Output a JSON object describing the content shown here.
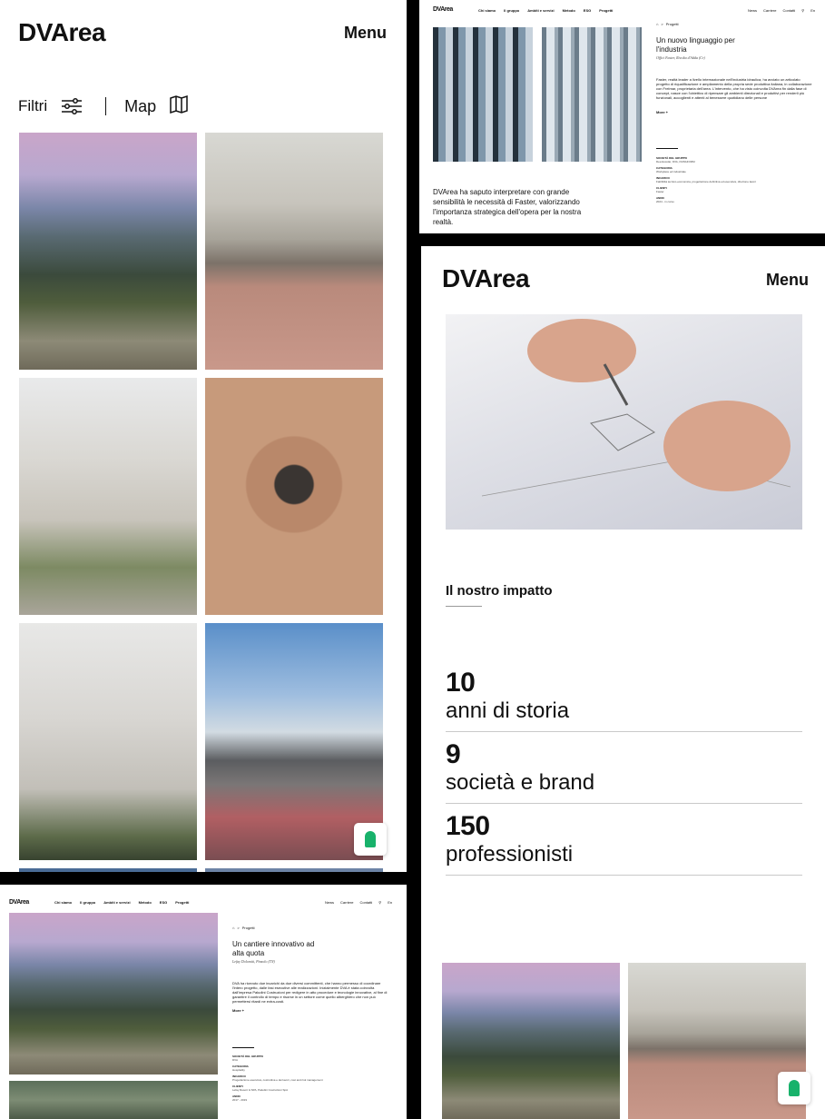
{
  "brand": "DVArea",
  "menu_label": "Menu",
  "filters": {
    "filter_label": "Filtri",
    "map_label": "Map"
  },
  "project_grid": {
    "items": [
      {
        "image": "alpine-chalet-hotel"
      },
      {
        "image": "indoor-athletics-arena"
      },
      {
        "image": "white-residential-building"
      },
      {
        "image": "desert-construction-site"
      },
      {
        "image": "stone-residential-building"
      },
      {
        "image": "velodrome-track-arena"
      }
    ]
  },
  "nav": {
    "items": [
      "Chi siamo",
      "Il gruppo",
      "Ambiti e servizi",
      "Metodo",
      "ESG",
      "Progetti"
    ],
    "right": [
      "News",
      "Carriere",
      "Contatti"
    ],
    "lang": "En"
  },
  "project_faster": {
    "breadcrumb": "Progetti",
    "title": "Un nuovo linguaggio per l'industria",
    "subtitle": "Offici Faster, Rivolta d'Adda (Cr)",
    "body": "Faster, realtà leader a livello internazionale nell'industria idraulica, ha avviato un articolato progetto di riqualificazione e ampliamento della propria sede produttiva italiana, in collaborazione con Frelmar, proprietaria dell'area. L'intervento, che ha visto coinvolta DVArea fin dalla fase di concept, nasce con l'obiettivo di ripensare gli ambienti direzionali e produttivi per renderli più funzionali, accoglienti e attenti al benessere quotidiano delle persone",
    "more": "More +",
    "quote": "DVArea ha saputo interpretare con grande sensibilità le necessità di Faster, valorizzando l'importanza strategica dell'opera per la nostra realtà.",
    "meta": [
      {
        "label": "Società del gruppo",
        "value": "Dea Escolar, DVA, DVRAFORM"
      },
      {
        "label": "Categoria",
        "value": "Workplace ed industriale"
      },
      {
        "label": "Incarico",
        "value": "Fattibilità tecnico-economica, progettazione definitiva ed esecutiva, direzione lavori"
      },
      {
        "label": "Clienti",
        "value": "Faster"
      },
      {
        "label": "Anno",
        "value": "2024 - in corso"
      }
    ]
  },
  "impact": {
    "heading": "Il nostro impatto",
    "stats": [
      {
        "value": "10",
        "label": "anni di storia"
      },
      {
        "value": "9",
        "label": "società e brand"
      },
      {
        "value": "150",
        "label": "professionisti"
      }
    ]
  },
  "project_lefay": {
    "breadcrumb": "Progetti",
    "title": "Un cantiere innovativo ad alta quota",
    "subtitle": "Lefay Dolomiti, Pinzolo (TN)",
    "body": "DVA ha ricevuto due incarichi da due diversi committenti, che hanno permesso di coordinare l'intero progetto, dalle fasi esecutive alle realizzazioni. Inizialmente DVA è stata coinvolta dall'impresa Paludini Costruzioni per redigere in atto procedure e tecnologie innovative, al fine di garantire il controllo di tempo e risorse in un settore come quello alberghiero che non può permettersi ritardi ne extra-costi.",
    "more": "More +",
    "meta": [
      {
        "label": "Società del gruppo",
        "value": "DVA"
      },
      {
        "label": "Categoria",
        "value": "Hospitality"
      },
      {
        "label": "Incarico",
        "value": "Progettazione esecutiva, costruttiva e dei lavori, cost and risk management"
      },
      {
        "label": "Clienti",
        "value": "Lefay Resort & SPA, Paludini Costruzioni SpA"
      },
      {
        "label": "Anno",
        "value": "2017 - 2019"
      }
    ]
  }
}
